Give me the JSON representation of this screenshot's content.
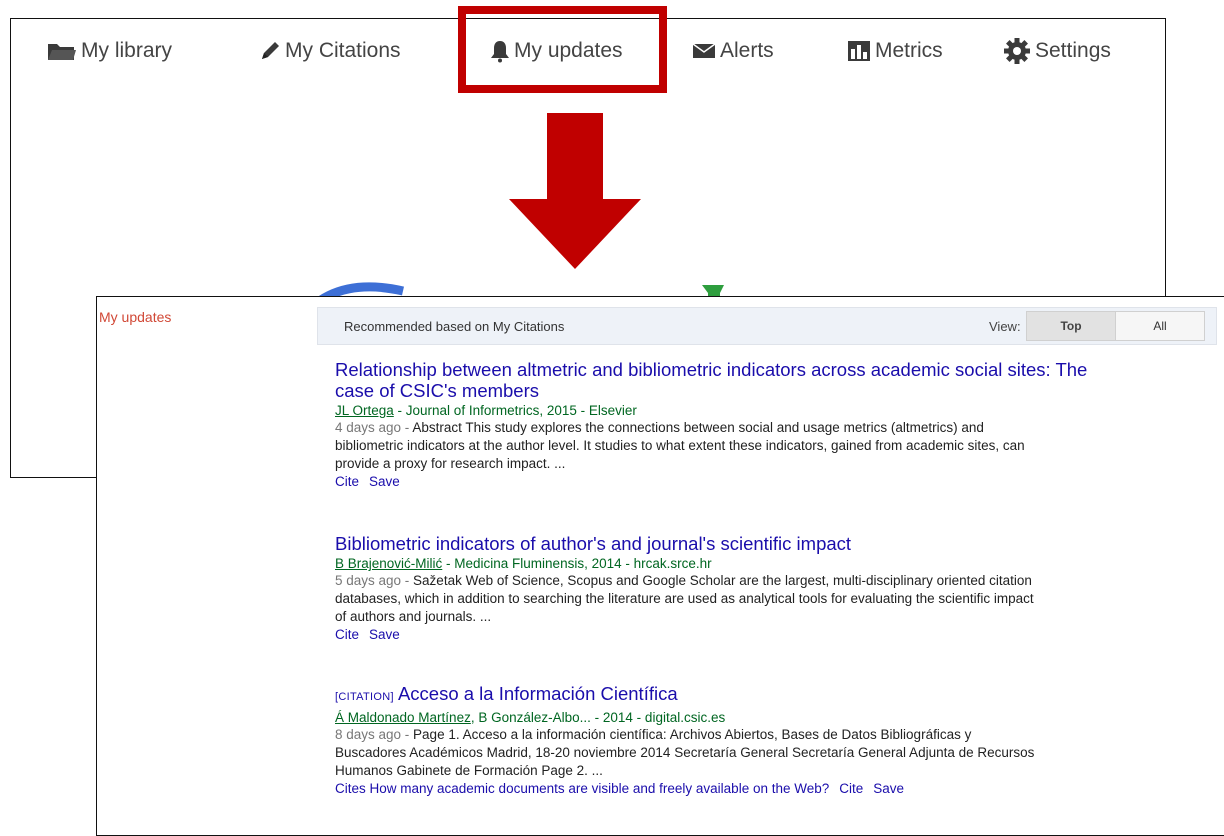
{
  "nav": {
    "items": [
      {
        "label": "My library",
        "icon": "folder-icon"
      },
      {
        "label": "My Citations",
        "icon": "pencil-icon"
      },
      {
        "label": "My updates",
        "icon": "bell-icon"
      },
      {
        "label": "Alerts",
        "icon": "envelope-icon"
      },
      {
        "label": "Metrics",
        "icon": "bar-chart-icon"
      },
      {
        "label": "Settings",
        "icon": "gear-icon"
      }
    ],
    "highlighted": "My updates"
  },
  "colors": {
    "highlight": "#c00000",
    "link": "#1a0dab",
    "meta_green": "#006621",
    "side_label": "#d14836"
  },
  "updates": {
    "side_label": "My updates",
    "header": "Recommended based on My Citations",
    "view_label": "View:",
    "view_options": [
      "Top",
      "All"
    ],
    "selected_view": "Top",
    "results": [
      {
        "title_line1": "Relationship between altmetric and bibliometric indicators across academic social sites: The",
        "title_line2": "case of CSIC's members",
        "author": "JL Ortega",
        "meta_rest": " - Journal of Informetrics, 2015 - Elsevier",
        "age": "4 days ago - ",
        "snippet": "Abstract This study explores the connections between social and usage metrics (altmetrics) and bibliometric indicators at the author level. It studies to what extent these indicators, gained from academic sites, can provide a proxy for research impact. ...",
        "actions": [
          "Cite",
          "Save"
        ]
      },
      {
        "title_line1": "Bibliometric indicators of author's and journal's scientific impact",
        "author": "B Brajenović-Milić",
        "meta_rest": " - Medicina Fluminensis, 2014 - hrcak.srce.hr",
        "age": "5 days ago - ",
        "snippet": "Sažetak Web of Science, Scopus and Google Scholar are the largest, multi-disciplinary oriented citation databases, which in addition to searching the literature are used as analytical tools for evaluating the scientific impact of authors and journals. ...",
        "actions": [
          "Cite",
          "Save"
        ]
      },
      {
        "tag": "[CITATION]",
        "title_line1": "Acceso a la Información Científica",
        "author": "Á Maldonado Martínez",
        "author2": "B González-Albo...",
        "meta_rest": " - 2014 - digital.csic.es",
        "age": "8 days ago - ",
        "snippet": "Page 1. Acceso a la información científica: Archivos Abiertos, Bases de Datos Bibliográficas y Buscadores Académicos Madrid, 18-20 noviembre 2014 Secretaría General Secretaría General Adjunta de Recursos Humanos Gabinete de Formación Page 2. ...",
        "actions": [
          "Cites How many academic documents are visible and freely available on the Web?",
          "Cite",
          "Save"
        ]
      }
    ]
  }
}
